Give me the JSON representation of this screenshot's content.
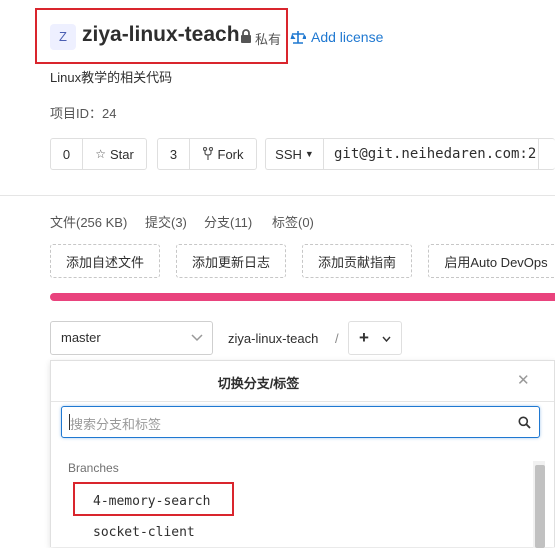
{
  "project": {
    "avatar_letter": "Z",
    "title": "ziya-linux-teach",
    "visibility": "私有",
    "license_link": "Add license",
    "description": "Linux教学的相关代码",
    "id_label": "项目ID：24"
  },
  "actions": {
    "star_count": "0",
    "star_label": "Star",
    "fork_count": "3",
    "fork_label": "Fork",
    "protocol": "SSH",
    "clone_url": "git@git.neihedaren.com:2"
  },
  "stats": {
    "files": "文件(256 KB)",
    "commits": "提交(3)",
    "branches": "分支(11)",
    "tags": "标签(0)"
  },
  "quick_actions": [
    "添加自述文件",
    "添加更新日志",
    "添加贡献指南",
    "启用Auto DevOps"
  ],
  "repo_nav": {
    "branch": "master",
    "path": "ziya-linux-teach",
    "separator": "/",
    "add": "+"
  },
  "dropdown": {
    "title": "切换分支/标签",
    "search_placeholder": "搜索分支和标签",
    "section": "Branches",
    "items": [
      "4-memory-search",
      "socket-client"
    ]
  },
  "colors": {
    "accent": "#1f78d1",
    "highlight": "#d9252d",
    "progress": "#e9437d"
  }
}
